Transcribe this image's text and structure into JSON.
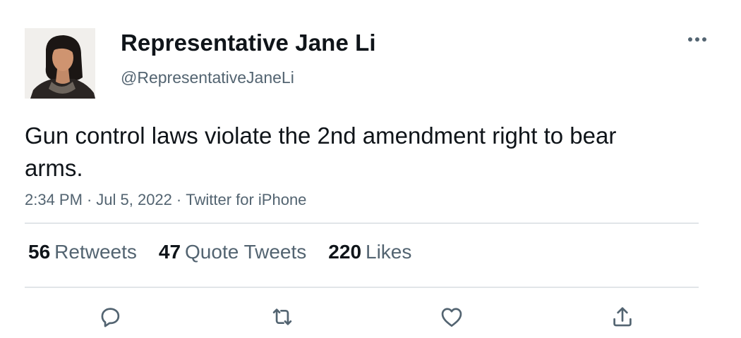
{
  "author": {
    "name": "Representative Jane Li",
    "handle": "@RepresentativeJaneLi",
    "avatar_icon": "profile-photo"
  },
  "tweet": {
    "text": "Gun control laws violate the 2nd amendment right to bear arms.",
    "time": "2:34 PM",
    "date": "Jul 5, 2022",
    "source": "Twitter for iPhone",
    "separator": "·"
  },
  "stats": {
    "retweets": {
      "count": "56",
      "label": "Retweets"
    },
    "quotes": {
      "count": "47",
      "label": "Quote Tweets"
    },
    "likes": {
      "count": "220",
      "label": "Likes"
    }
  },
  "actions": {
    "reply": "reply-icon",
    "retweet": "retweet-icon",
    "like": "heart-icon",
    "share": "share-icon",
    "more": "more-icon"
  },
  "colors": {
    "primary_text": "#0f1419",
    "secondary_text": "#536471",
    "divider": "#e1e5e8",
    "icon": "#536471"
  }
}
